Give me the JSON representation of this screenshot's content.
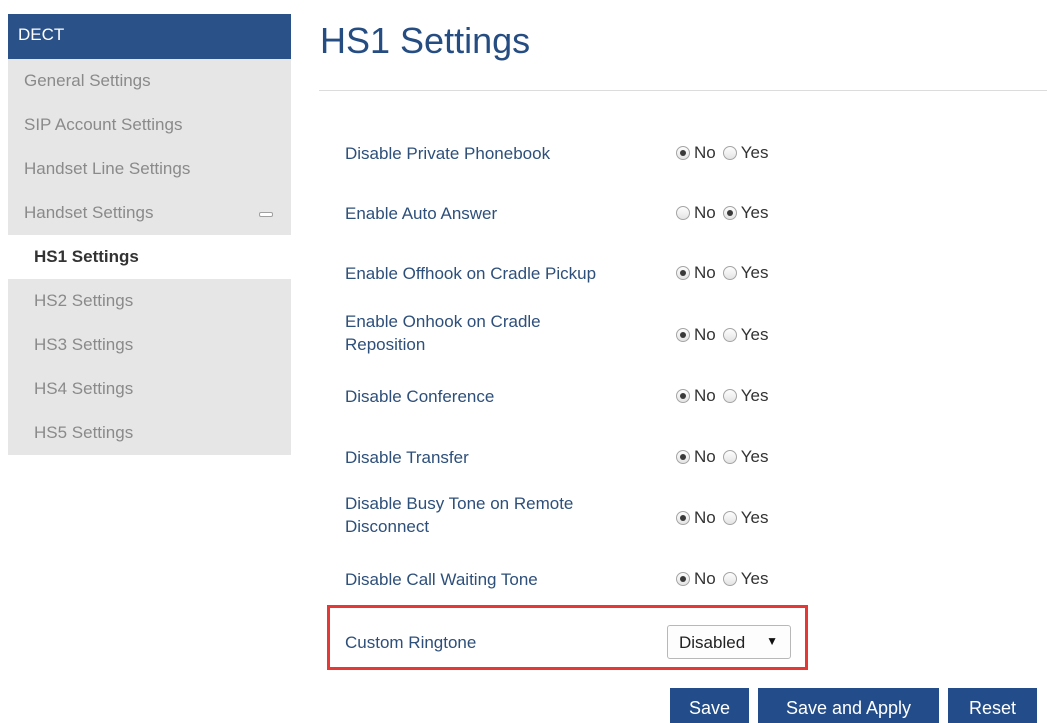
{
  "sidebar": {
    "header": "DECT",
    "items": [
      {
        "label": "General Settings"
      },
      {
        "label": "SIP Account Settings"
      },
      {
        "label": "Handset Line Settings"
      },
      {
        "label": "Handset Settings"
      },
      {
        "label": "HS1 Settings"
      },
      {
        "label": "HS2 Settings"
      },
      {
        "label": "HS3 Settings"
      },
      {
        "label": "HS4 Settings"
      },
      {
        "label": "HS5 Settings"
      }
    ],
    "active_item": "HS1 Settings"
  },
  "page": {
    "title": "HS1 Settings"
  },
  "options": {
    "no": "No",
    "yes": "Yes"
  },
  "settings": [
    {
      "label": "Disable Private Phonebook",
      "value": "No"
    },
    {
      "label": "Enable Auto Answer",
      "value": "Yes"
    },
    {
      "label": "Enable Offhook on Cradle Pickup",
      "value": "No"
    },
    {
      "label": "Enable Onhook on Cradle Reposition",
      "value": "No"
    },
    {
      "label": "Disable Conference",
      "value": "No"
    },
    {
      "label": "Disable Transfer",
      "value": "No"
    },
    {
      "label": "Disable Busy Tone on Remote Disconnect",
      "value": "No"
    },
    {
      "label": "Disable Call Waiting Tone",
      "value": "No"
    }
  ],
  "custom_ringtone": {
    "label": "Custom Ringtone",
    "selected": "Disabled"
  },
  "buttons": {
    "save": "Save",
    "save_apply": "Save and Apply",
    "reset": "Reset"
  },
  "colors": {
    "accent": "#224d8a",
    "sidebar_bg": "#e6e6e6",
    "highlight": "#e53935"
  }
}
